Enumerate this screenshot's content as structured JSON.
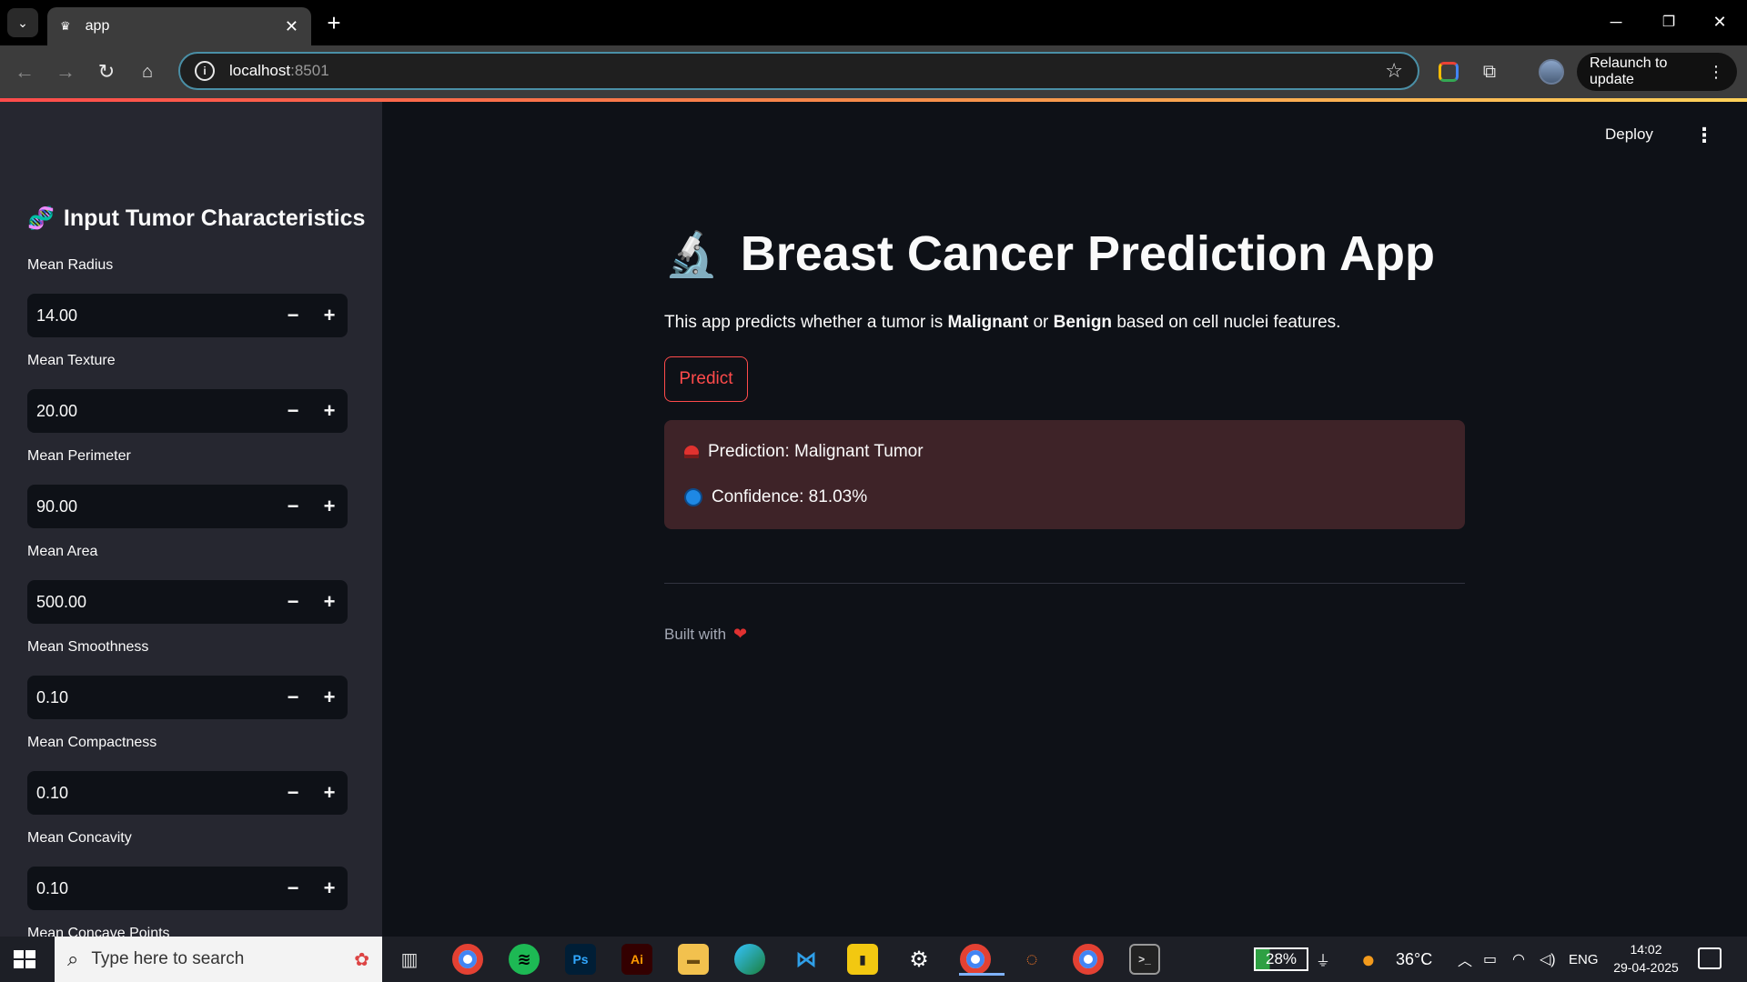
{
  "browser": {
    "tab_title": "app",
    "tab_close": "✕",
    "new_tab": "+",
    "url_host": "localhost",
    "url_port": ":8501",
    "relaunch_label": "Relaunch to update",
    "controls": {
      "minimize": "─",
      "restore": "❐",
      "close": "✕"
    }
  },
  "sidebar": {
    "title": "Input Tumor Characteristics",
    "title_icon": "dna-icon",
    "fields": [
      {
        "label": "Mean Radius",
        "value": "14.00"
      },
      {
        "label": "Mean Texture",
        "value": "20.00"
      },
      {
        "label": "Mean Perimeter",
        "value": "90.00"
      },
      {
        "label": "Mean Area",
        "value": "500.00"
      },
      {
        "label": "Mean Smoothness",
        "value": "0.10"
      },
      {
        "label": "Mean Compactness",
        "value": "0.10"
      },
      {
        "label": "Mean Concavity",
        "value": "0.10"
      },
      {
        "label": "Mean Concave Points",
        "value": ""
      }
    ],
    "minus": "−",
    "plus": "+"
  },
  "header": {
    "deploy_label": "Deploy",
    "menu_icon": "kebab-menu-icon"
  },
  "main": {
    "title": "Breast Cancer Prediction App",
    "title_icon": "microscope-icon",
    "intro_before": "This app predicts whether a tumor is ",
    "intro_bold1": "Malignant",
    "intro_mid": " or ",
    "intro_bold2": "Benign",
    "intro_after": " based on cell nuclei features.",
    "predict_label": "Predict",
    "prediction_text": "Prediction: Malignant Tumor",
    "confidence_text": "Confidence: 81.03%",
    "footer_text": "Built with",
    "footer_icon": "heart-icon"
  },
  "taskbar": {
    "search_placeholder": "Type here to search",
    "apps": [
      "Chrome",
      "Spotify",
      "Ps",
      "Ai",
      "File Explorer",
      "Edge",
      "VS Code",
      "Power BI",
      "Settings",
      "Chrome",
      "Jupyter",
      "Chrome",
      "Terminal"
    ],
    "battery": "28%",
    "weather": "36°C",
    "language": "ENG",
    "time": "14:02",
    "date": "29-04-2025"
  },
  "colors": {
    "accent": "#ff4b4b",
    "sidebar_bg": "#262730",
    "main_bg": "#0e1117",
    "alert_bg": "#3e2328"
  }
}
